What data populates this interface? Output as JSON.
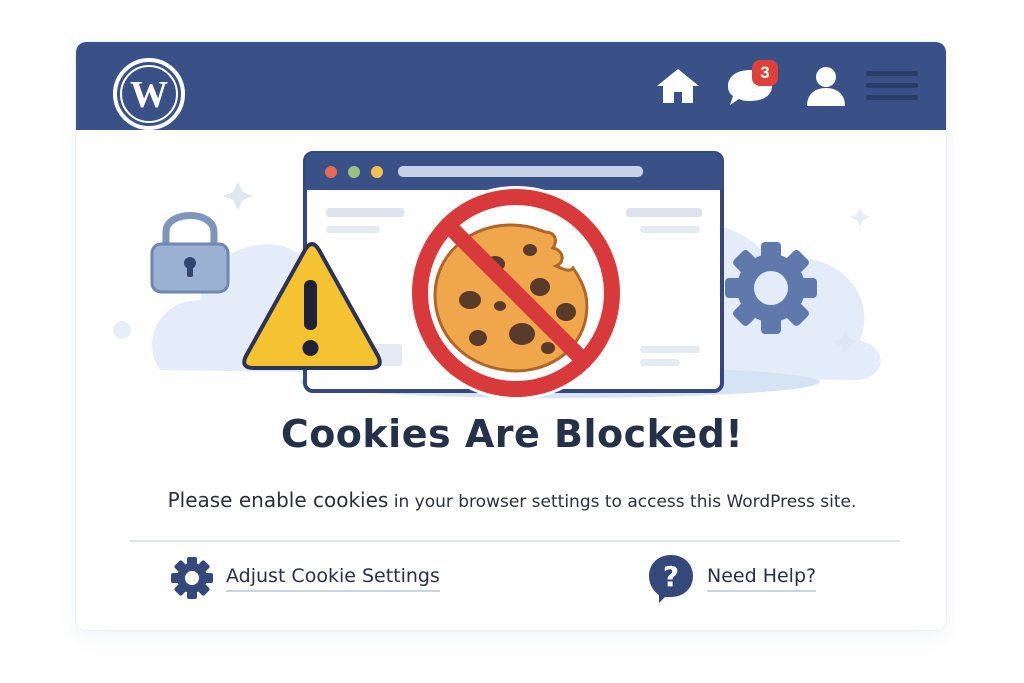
{
  "topbar": {
    "logo_icon": "wordpress-logo-icon",
    "icons": [
      "home-icon",
      "chat-icon",
      "user-icon",
      "menu-icon"
    ],
    "notification_count": "3",
    "color": "#3a5187"
  },
  "illustration": {
    "icons": [
      "lock-icon",
      "warning-icon",
      "browser-window",
      "blocked-cookie-icon",
      "gear-icon"
    ]
  },
  "main": {
    "title": "Cookies Are Blocked!",
    "subtitle_large": "Please enable cookies",
    "subtitle_small": " in your browser settings to access this WordPress site."
  },
  "actions": {
    "adjust_label": "Adjust Cookie Settings",
    "help_label": "Need Help?"
  },
  "colors": {
    "accent": "#3a5187",
    "warning": "#f5c232",
    "danger": "#d8393a",
    "title": "#253049"
  }
}
